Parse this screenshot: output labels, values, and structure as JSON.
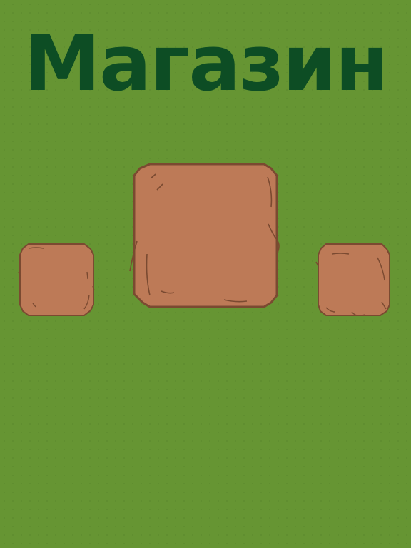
{
  "shop": {
    "title": "Магазин",
    "title_color": "#0d4d24"
  },
  "colors": {
    "background": "#669533",
    "slot_fill": "#bd7a57",
    "slot_border": "#7a4a31"
  },
  "slots": [
    {
      "position": "left"
    },
    {
      "position": "center",
      "selected": true
    },
    {
      "position": "right"
    }
  ]
}
